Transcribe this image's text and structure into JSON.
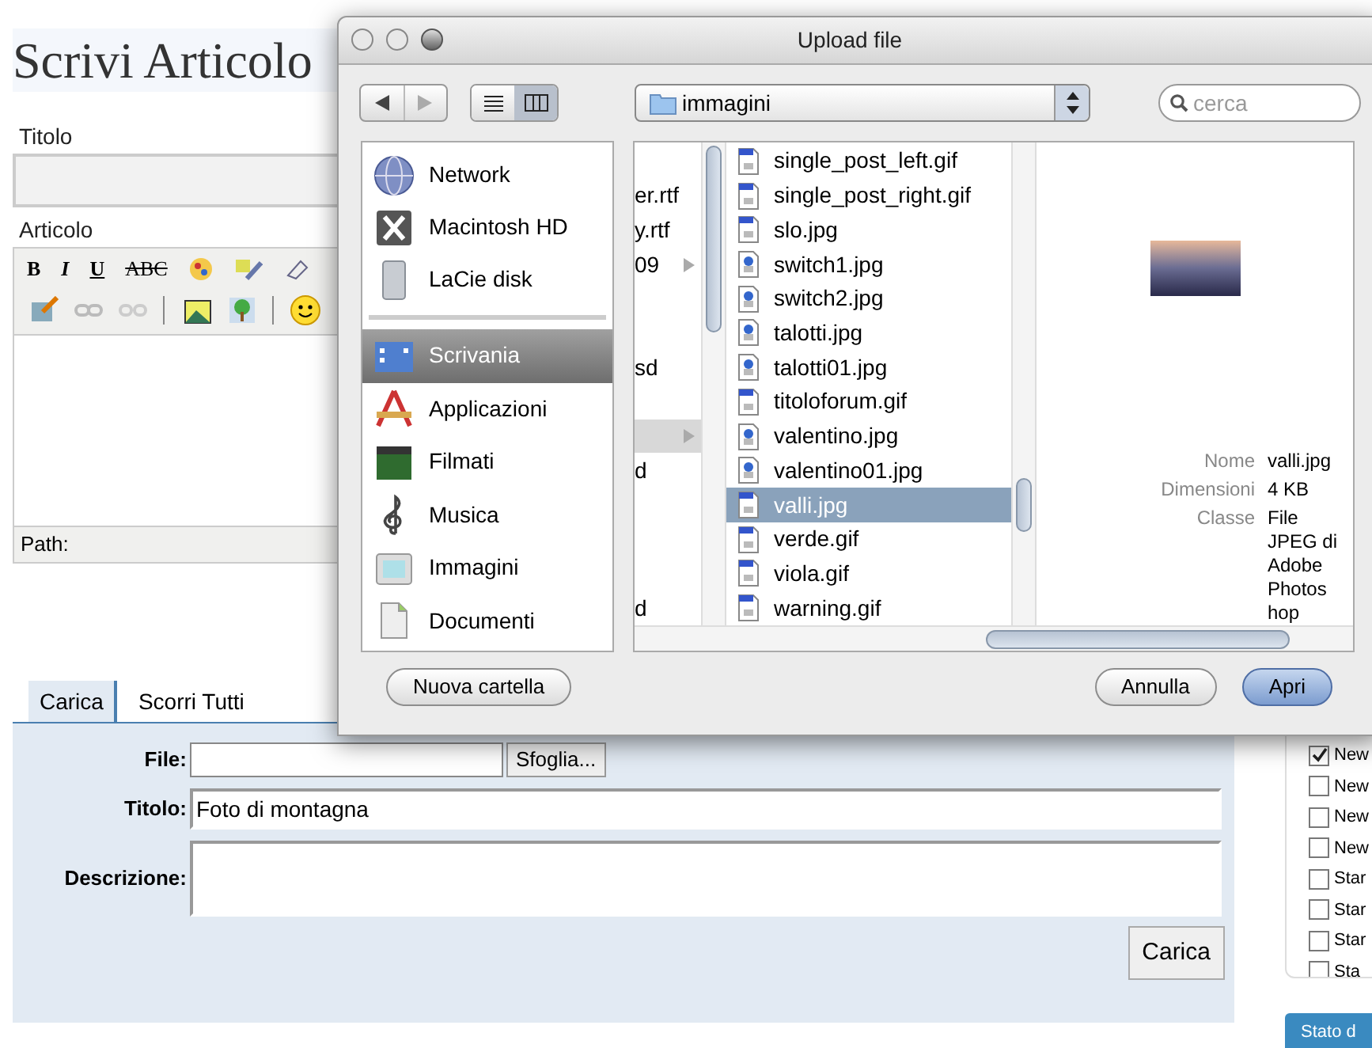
{
  "page": {
    "title": "Scrivi Articolo",
    "titolo_label": "Titolo",
    "articolo_label": "Articolo",
    "editor": {
      "format_buttons": [
        {
          "kind": "bold",
          "label": "B"
        },
        {
          "kind": "italic",
          "label": "I"
        },
        {
          "kind": "underline",
          "label": "U"
        },
        {
          "kind": "strike",
          "label": "ABC"
        }
      ],
      "path_label": "Path:"
    },
    "tabs": [
      {
        "label": "Carica",
        "selected": true
      },
      {
        "label": "Scorri Tutti",
        "selected": false
      }
    ],
    "form": {
      "file_label": "File:",
      "browse_button": "Sfoglia...",
      "title_label": "Titolo:",
      "title_value": "Foto di montagna",
      "description_label": "Descrizione:",
      "submit_button": "Carica"
    },
    "side_checklist": [
      {
        "label": "New",
        "checked": true
      },
      {
        "label": "New",
        "checked": false
      },
      {
        "label": "New",
        "checked": false
      },
      {
        "label": "New",
        "checked": false
      },
      {
        "label": "Star",
        "checked": false
      },
      {
        "label": "Star",
        "checked": false
      },
      {
        "label": "Star",
        "checked": false
      },
      {
        "label": "Sta",
        "checked": false
      }
    ],
    "side_button": "Stato d"
  },
  "dialog": {
    "title": "Upload file",
    "view_buttons": [
      {
        "kind": "list",
        "selected": false
      },
      {
        "kind": "columns",
        "selected": true
      }
    ],
    "location": "immagini",
    "search_placeholder": "cerca",
    "sidebar": {
      "devices": [
        {
          "kind": "network",
          "label": "Network",
          "selected": false
        },
        {
          "kind": "hd",
          "label": "Macintosh HD",
          "selected": false
        },
        {
          "kind": "disk",
          "label": "LaCie disk",
          "selected": false
        }
      ],
      "places": [
        {
          "kind": "desktop",
          "label": "Scrivania",
          "selected": true
        },
        {
          "kind": "apps",
          "label": "Applicazioni",
          "selected": false
        },
        {
          "kind": "movies",
          "label": "Filmati",
          "selected": false
        },
        {
          "kind": "music",
          "label": "Musica",
          "selected": false
        },
        {
          "kind": "pictures",
          "label": "Immagini",
          "selected": false
        },
        {
          "kind": "documents",
          "label": "Documenti",
          "selected": false
        }
      ]
    },
    "parent_column": [
      {
        "kind": "blank"
      },
      {
        "kind": "item",
        "text": "er.rtf",
        "selected": false
      },
      {
        "kind": "item",
        "text": "y.rtf",
        "selected": false
      },
      {
        "kind": "item",
        "text": "09",
        "folder": true,
        "selected": false
      },
      {
        "kind": "blank"
      },
      {
        "kind": "blank"
      },
      {
        "kind": "item",
        "text": "sd",
        "selected": false
      },
      {
        "kind": "blank"
      },
      {
        "kind": "item",
        "folder": true,
        "selected": true
      },
      {
        "kind": "item",
        "text": "d",
        "selected": false
      },
      {
        "kind": "blank"
      },
      {
        "kind": "blank"
      },
      {
        "kind": "blank"
      },
      {
        "kind": "item",
        "text": "d",
        "selected": false
      }
    ],
    "files": [
      {
        "name": "single_post_left.gif",
        "kind": "gif",
        "selected": false
      },
      {
        "name": "single_post_right.gif",
        "kind": "gif",
        "selected": false
      },
      {
        "name": "slo.jpg",
        "kind": "gif",
        "selected": false
      },
      {
        "name": "switch1.jpg",
        "kind": "jpg",
        "selected": false
      },
      {
        "name": "switch2.jpg",
        "kind": "jpg",
        "selected": false
      },
      {
        "name": "talotti.jpg",
        "kind": "jpg",
        "selected": false
      },
      {
        "name": "talotti01.jpg",
        "kind": "jpg",
        "selected": false
      },
      {
        "name": "titoloforum.gif",
        "kind": "gif",
        "selected": false
      },
      {
        "name": "valentino.jpg",
        "kind": "jpg",
        "selected": false
      },
      {
        "name": "valentino01.jpg",
        "kind": "jpg",
        "selected": false
      },
      {
        "name": "valli.jpg",
        "kind": "gif",
        "selected": true
      },
      {
        "name": "verde.gif",
        "kind": "gif",
        "selected": false
      },
      {
        "name": "viola.gif",
        "kind": "gif",
        "selected": false
      },
      {
        "name": "warning.gif",
        "kind": "gif",
        "selected": false
      }
    ],
    "preview": {
      "info": [
        {
          "label": "Nome",
          "value": "valli.jpg"
        },
        {
          "label": "Dimensioni",
          "value": "4 KB"
        },
        {
          "label": "Classe",
          "value": "File JPEG di Adobe Photos hop"
        }
      ]
    },
    "buttons": [
      {
        "kind": "secondary",
        "label": "Nuova cartella"
      },
      {
        "kind": "cancel",
        "label": "Annulla"
      },
      {
        "kind": "default",
        "label": "Apri"
      }
    ]
  }
}
